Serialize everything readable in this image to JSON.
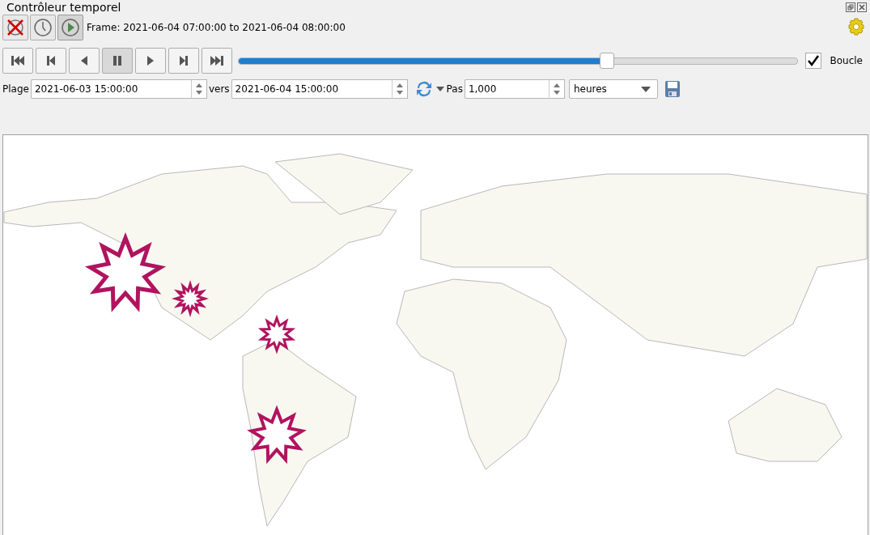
{
  "panel": {
    "title": "Contrôleur temporel"
  },
  "modes": [
    {
      "kind": "off",
      "selected": false
    },
    {
      "kind": "fixed",
      "selected": false
    },
    {
      "kind": "animated",
      "selected": true
    }
  ],
  "frame_label": "Frame: 2021-06-04 07:00:00 to 2021-06-04 08:00:00",
  "transport": [
    {
      "kind": "first",
      "selected": false
    },
    {
      "kind": "back",
      "selected": false
    },
    {
      "kind": "reverse",
      "selected": false
    },
    {
      "kind": "pause",
      "selected": true
    },
    {
      "kind": "play",
      "selected": false
    },
    {
      "kind": "next",
      "selected": false
    },
    {
      "kind": "last",
      "selected": false
    }
  ],
  "slider": {
    "level": 0.66
  },
  "loop": {
    "label": "Boucle",
    "checked": true
  },
  "range": {
    "label": "Plage",
    "start": "2021-06-03 15:00:00",
    "to_label": "vers",
    "end": "2021-06-04 15:00:00"
  },
  "step": {
    "label": "Pas",
    "value": "1,000",
    "unit": "heures"
  }
}
